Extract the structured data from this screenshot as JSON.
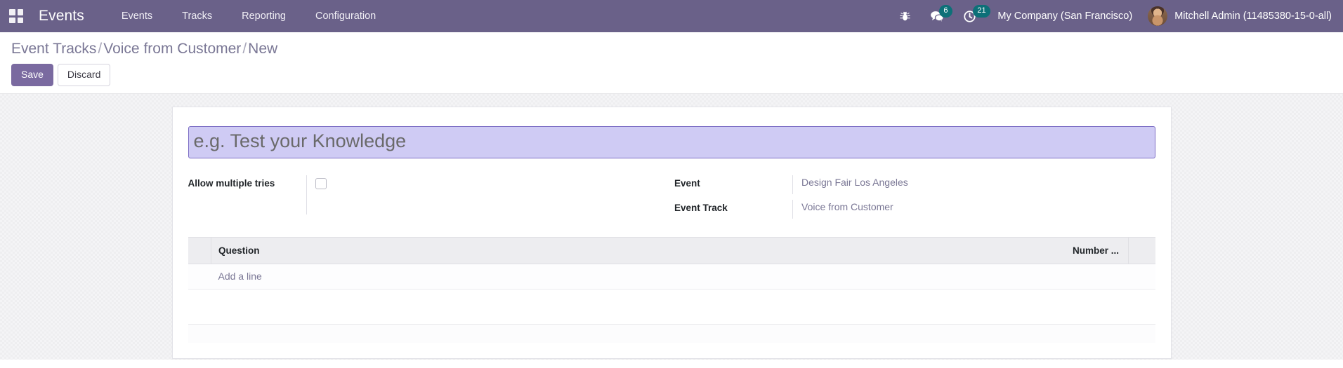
{
  "navbar": {
    "apps_icon": "apps-grid-icon",
    "brand": "Events",
    "menu": [
      {
        "label": "Events"
      },
      {
        "label": "Tracks"
      },
      {
        "label": "Reporting"
      },
      {
        "label": "Configuration"
      }
    ],
    "sys_icons": [
      {
        "name": "bug-icon",
        "badge": null
      },
      {
        "name": "messages-icon",
        "badge": "6"
      },
      {
        "name": "activities-clock-icon",
        "badge": "21"
      }
    ],
    "messages_badge": "6",
    "activities_badge": "21",
    "company": "My Company (San Francisco)",
    "user": "Mitchell Admin (11485380-15-0-all)",
    "colors": {
      "navbar_bg": "#6a6189",
      "badge_bg": "#0d7078"
    }
  },
  "control_panel": {
    "breadcrumb": {
      "root": "Event Tracks",
      "parent": "Voice from Customer",
      "current": "New",
      "separator": "/"
    },
    "save_label": "Save",
    "discard_label": "Discard",
    "primary_color": "#7a6aa0"
  },
  "form": {
    "title": {
      "value": "",
      "placeholder": "e.g. Test your Knowledge",
      "focus_bg": "#cfcbf4",
      "focus_border": "#7b6cc4"
    },
    "left_fields": [
      {
        "label": "Allow multiple tries",
        "type": "checkbox",
        "checked": false
      }
    ],
    "right_fields": [
      {
        "label": "Event",
        "value": "Design Fair Los Angeles",
        "type": "link"
      },
      {
        "label": "Event Track",
        "value": "Voice from Customer",
        "type": "link"
      }
    ],
    "questions_list": {
      "columns": [
        "Question",
        "Number ..."
      ],
      "rows": [],
      "add_line_label": "Add a line"
    }
  }
}
